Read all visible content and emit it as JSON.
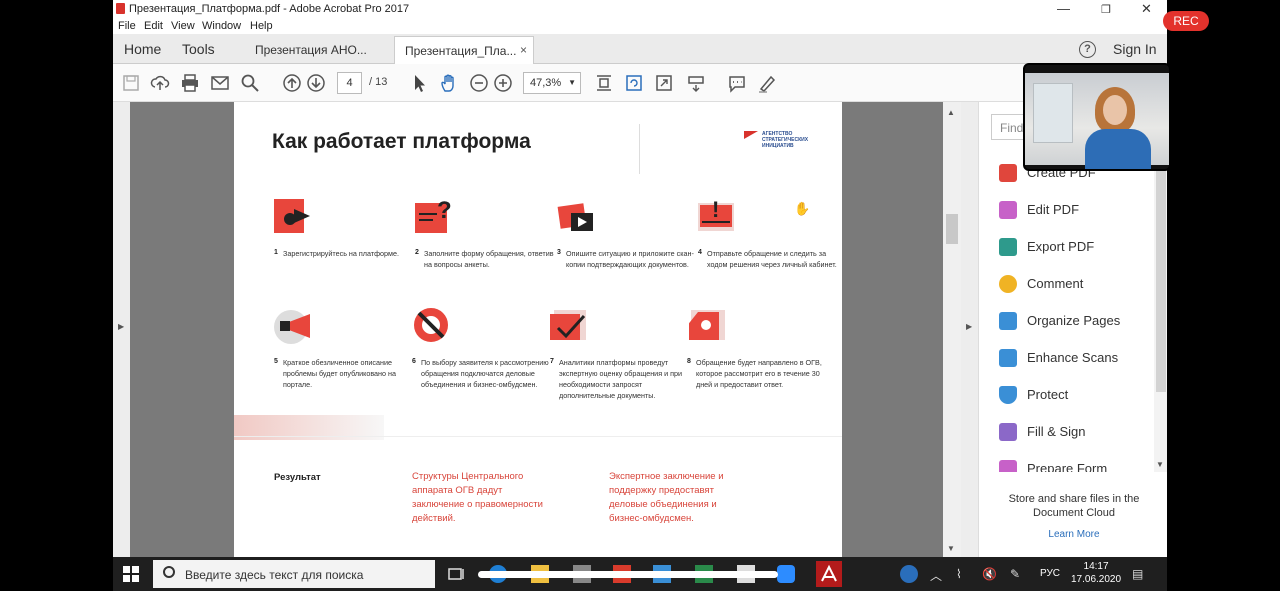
{
  "window": {
    "title": "Презентация_Платформа.pdf - Adobe Acrobat Pro 2017",
    "minimize": "—",
    "maximize": "❐",
    "close": "✕"
  },
  "menu": [
    "File",
    "Edit",
    "View",
    "Window",
    "Help"
  ],
  "nav": {
    "home": "Home",
    "tools": "Tools"
  },
  "tabs": [
    {
      "label": "Презентация АНО..."
    },
    {
      "label": "Презентация_Плa...",
      "close": "×"
    }
  ],
  "header": {
    "help": "?",
    "signin": "Sign In"
  },
  "toolbar": {
    "page_current": "4",
    "page_total": "/ 13",
    "zoom": "47,3%",
    "zoom_dropdown": "▼"
  },
  "page": {
    "title": "Как работает платформа",
    "logo_text": "АГЕНТСТВО СТРАТЕГИЧЕСКИХ ИНИЦИАТИВ",
    "steps": [
      {
        "num": "1",
        "text": "Зарегистрируйтесь на платформе."
      },
      {
        "num": "2",
        "text": "Заполните форму обращения, ответив на вопросы анкеты."
      },
      {
        "num": "3",
        "text": "Опишите ситуацию и приложите скан-копии подтверждающих документов."
      },
      {
        "num": "4",
        "text": "Отправьте обращение и следить за ходом решения через личный кабинет."
      },
      {
        "num": "5",
        "text": "Краткое обезличенное описание проблемы будет опубликовано на портале."
      },
      {
        "num": "6",
        "text": "По выбору заявителя к рассмотрению обращения подключатся деловые объединения и бизнес-омбудсмен."
      },
      {
        "num": "7",
        "text": "Аналитики платформы проведут экспертную оценку обращения и при необходимости запросят дополнительные документы."
      },
      {
        "num": "8",
        "text": "Обращение будет направлено в ОГВ, которое рассмотрит его в течение 30 дней и предоставит ответ."
      }
    ],
    "result_label": "Результат",
    "result_1": "Структуры Центрального аппарата ОГВ дадут заключение о правомерности действий.",
    "result_2": "Экспертное заключение и поддержку предоставят деловые объединения и бизнес-омбудсмен."
  },
  "rightpane": {
    "find_placeholder": "Find",
    "items": [
      {
        "label": "Create PDF",
        "color": "#e0463c"
      },
      {
        "label": "Edit PDF",
        "color": "#c761c8"
      },
      {
        "label": "Export PDF",
        "color": "#2e9a8c"
      },
      {
        "label": "Comment",
        "color": "#f0b324"
      },
      {
        "label": "Organize Pages",
        "color": "#3a8fd6"
      },
      {
        "label": "Enhance Scans",
        "color": "#3a8fd6"
      },
      {
        "label": "Protect",
        "color": "#3a8fd6"
      },
      {
        "label": "Fill & Sign",
        "color": "#8b68c8"
      },
      {
        "label": "Prepare Form",
        "color": "#c761c8"
      }
    ],
    "cloud_text": "Store and share files in the Document Cloud",
    "learn_more": "Learn More"
  },
  "recording": {
    "label": "REC"
  },
  "taskbar": {
    "search_placeholder": "Введите здесь текст для поиска",
    "lang": "РУС",
    "time": "14:17",
    "date": "17.06.2020"
  }
}
